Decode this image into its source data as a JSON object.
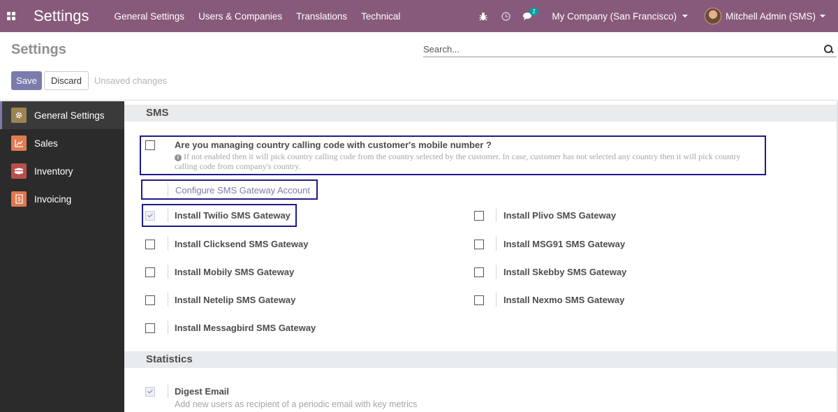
{
  "navbar": {
    "app_title": "Settings",
    "menu": [
      "General Settings",
      "Users & Companies",
      "Translations",
      "Technical"
    ],
    "chat_count": "2",
    "company": "My Company (San Francisco)",
    "user": "Mitchell Admin (SMS)",
    "color": "#875a7b"
  },
  "control": {
    "title": "Settings",
    "search_placeholder": "Search...",
    "save_label": "Save",
    "discard_label": "Discard",
    "unsaved_label": "Unsaved changes"
  },
  "sidebar": {
    "items": [
      {
        "label": "General Settings",
        "icon": "gear-icon",
        "color": "#9a8450",
        "active": true
      },
      {
        "label": "Sales",
        "icon": "chart-icon",
        "color": "#e07c53",
        "active": false
      },
      {
        "label": "Inventory",
        "icon": "box-icon",
        "color": "#b84f4f",
        "active": false
      },
      {
        "label": "Invoicing",
        "icon": "invoice-icon",
        "color": "#e0774e",
        "active": false
      }
    ]
  },
  "sections": {
    "sms": {
      "title": "SMS",
      "country_code": {
        "label": "Are you managing country calling code with customer's mobile number ?",
        "help": "If not enabled then it will pick country calling code from the country selected by the customer. In case, customer has not selected any country then it will pick country calling code from company's country.",
        "checked": false
      },
      "configure_link": "Configure SMS Gateway Account",
      "gateways_left": [
        {
          "label": "Install Twilio SMS Gateway",
          "checked": true
        },
        {
          "label": "Install Clicksend SMS Gateway",
          "checked": false
        },
        {
          "label": "Install Mobily SMS Gateway",
          "checked": false
        },
        {
          "label": "Install Netelip SMS Gateway",
          "checked": false
        },
        {
          "label": "Install Messagbird SMS Gateway",
          "checked": false
        }
      ],
      "gateways_right": [
        {
          "label": "Install Plivo SMS Gateway",
          "checked": false
        },
        {
          "label": "Install MSG91 SMS Gateway",
          "checked": false
        },
        {
          "label": "Install Skebby SMS Gateway",
          "checked": false
        },
        {
          "label": "Install Nexmo SMS Gateway",
          "checked": false
        }
      ]
    },
    "statistics": {
      "title": "Statistics",
      "digest": {
        "label": "Digest Email",
        "help": "Add new users as recipient of a periodic email with key metrics",
        "checked": true
      }
    }
  },
  "highlight_color": "#1f1a8c"
}
